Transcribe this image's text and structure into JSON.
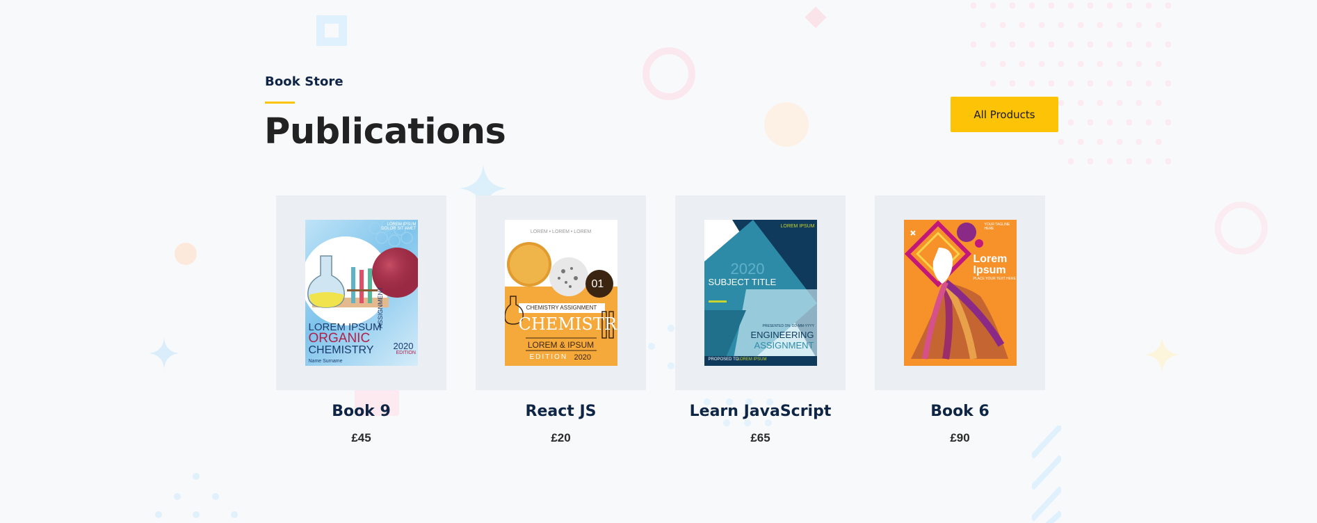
{
  "section": {
    "eyebrow": "Book Store",
    "title": "Publications",
    "all_products_label": "All Products"
  },
  "colors": {
    "accent": "#fcc307",
    "heading": "#0e2545",
    "card_bg": "#ebeff3"
  },
  "products": [
    {
      "title": "Book 9",
      "price": "£45",
      "cover": {
        "top_text": "LOREM IPSUM DOLOR SIT AMET",
        "line1": "LOREM IPSUM",
        "line2": "ORGANIC",
        "line3": "CHEMISTRY",
        "side": "ASSIGNMENT",
        "edition_year": "2020",
        "edition": "EDITION",
        "name": "Name Surname"
      }
    },
    {
      "title": "React JS",
      "price": "£20",
      "cover": {
        "top_text": "LOREM  •  LOREM  •  LOREM",
        "number": "01",
        "label": "CHEMISTRY ASSIGNMENT",
        "big": "CHEMISTR",
        "sub": "LOREM & IPSUM",
        "edition": "EDITION",
        "year": "2020"
      }
    },
    {
      "title": "Learn JavaScript",
      "price": "£65",
      "cover": {
        "corner": "LOREM IPSUM",
        "year": "2020",
        "subject": "SUBJECT TITLE",
        "presented": "PRESENTED ON: DD-MM-YYYY",
        "line1": "ENGINEERING",
        "line2": "ASSIGNMENT",
        "proposed": "PROPOSED TO:",
        "proposed_name": "LOREM IPSUM"
      }
    },
    {
      "title": "Book 6",
      "price": "£90",
      "cover": {
        "tag": "YOUR TAGLINE HERE",
        "line1": "Lorem",
        "line2": "Ipsum",
        "small": "PLACE YOUR TEXT HERE"
      }
    }
  ]
}
